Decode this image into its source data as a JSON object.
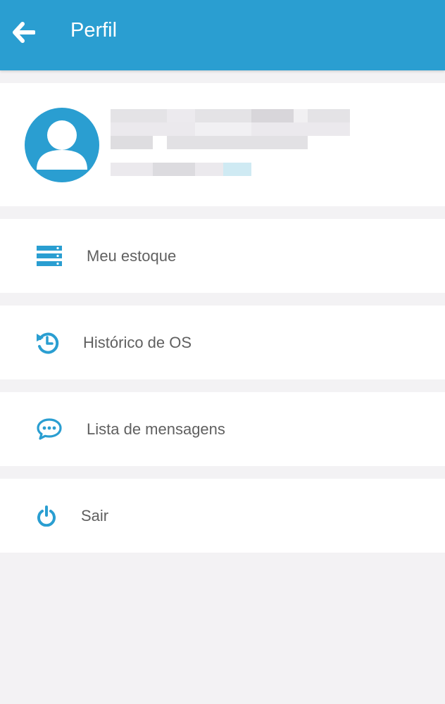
{
  "header": {
    "title": "Perfil",
    "back_icon": "arrow-left-icon",
    "background_color": "#2a9ed1"
  },
  "profile": {
    "avatar_icon": "user-avatar-icon",
    "accent_color": "#2a9ed1"
  },
  "menu": {
    "stock": {
      "label": "Meu estoque",
      "icon": "server-stack-icon"
    },
    "history": {
      "label": "Histórico de OS",
      "icon": "history-clock-icon"
    },
    "messages": {
      "label": "Lista de mensagens",
      "icon": "chat-bubble-icon"
    },
    "logout": {
      "label": "Sair",
      "icon": "power-icon"
    }
  }
}
